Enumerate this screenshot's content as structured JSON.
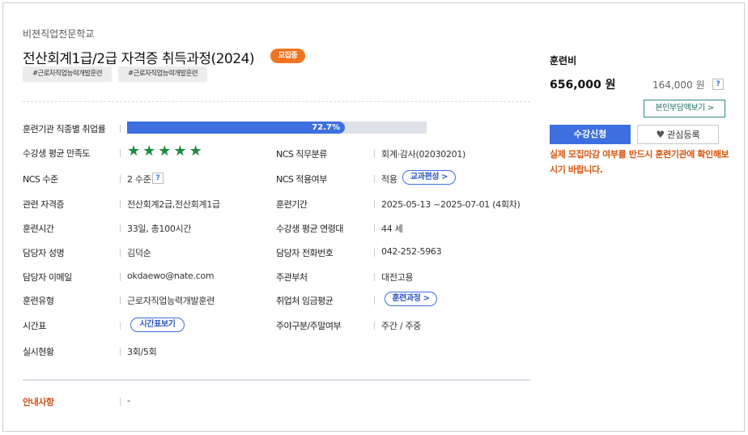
{
  "course": {
    "school": "비젼직업전문학교",
    "title": "전산회계1급/2급 자격증 취득과정(2024)",
    "status_badge": "모집중",
    "tags": [
      "#근로자직업능력개발훈련",
      "#근로자직업능력개발훈련"
    ]
  },
  "details": {
    "employment_rate_label": "훈련기관 직종별 취업률",
    "employment_rate_text": "72.7%",
    "employment_rate_value": 72.7,
    "satisfaction_label": "수강생 평균 만족도",
    "satisfaction_stars": 5,
    "ncs_level_label": "NCS 수준",
    "ncs_level_value": "2 수준",
    "ncs_level_help": "?",
    "related_cert_label": "관련 자격증",
    "related_cert_value": "전산회계2급,전산회계1급",
    "training_hours_label": "훈련시간",
    "training_hours_value": "33일, 총100시간",
    "manager_name_label": "담당자 성명",
    "manager_name_value": "김덕순",
    "manager_email_label": "담당자 이메일",
    "manager_email_value": "okdaewo@nate.com",
    "training_type_label": "훈련유형",
    "training_type_value": "근로자직업능력개발훈련",
    "timetable_label": "시간표",
    "timetable_button": "시간표보기",
    "realtime_label": "실시현황",
    "realtime_value": "3회/5회",
    "ncs_category_label": "NCS 직무분류",
    "ncs_category_value": "회계·감사(02030201)",
    "ncs_applied_label": "NCS 적용여부",
    "ncs_applied_value": "적용",
    "curriculum_button": "교과편성 >",
    "period_label": "훈련기간",
    "period_value": "2025-05-13 ~2025-07-01 (4회차)",
    "avg_age_label": "수강생 평균 연령대",
    "avg_age_value": "44 세",
    "manager_phone_label": "담당자 전화번호",
    "manager_phone_value": "042-252-5963",
    "ministry_label": "주관부처",
    "ministry_value": "대전고용",
    "avg_wage_label": "취업처 임금평균",
    "avg_wage_button": "훈련과정 >",
    "day_night_label": "주야구분/주말여부",
    "day_night_value": "주간 / 주중"
  },
  "guide": {
    "label": "안내사항",
    "value": "-"
  },
  "fee": {
    "label": "훈련비",
    "total": "656,000 원",
    "self_pay": "164,000 원",
    "help": "?",
    "self_pay_button": "본인부담액보기 >"
  },
  "actions": {
    "apply": "수강신청",
    "wishlist": "관심등록",
    "notice": "실제 모집마감 여부를 반드시 훈련기관에 확인해보시기 바랍니다."
  },
  "colors": {
    "accent_blue": "#3d6fe0",
    "badge_orange": "#f07422",
    "star_green": "#1f8a3e",
    "notice_orange": "#d8560f",
    "teal_border": "#2f8a80"
  }
}
